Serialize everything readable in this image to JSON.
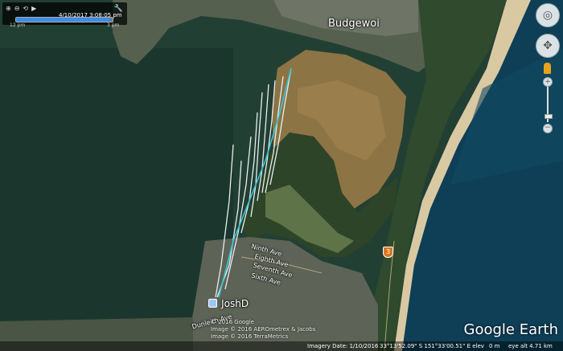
{
  "time_slider": {
    "date_time": "4/10/2017   3:08:05 pm",
    "start_label": "12 pm",
    "end_label": "3 pm",
    "progress": 0.97
  },
  "places": {
    "budgewoi": "Budgewoi",
    "ninth_ave": "Ninth Ave",
    "eighth_ave": "Eighth Ave",
    "seventh_ave": "Seventh Ave",
    "sixth_ave": "Sixth Ave",
    "dunleith_ave": "Dunleith Ave",
    "placemark": "JoshD",
    "route_shield": "3"
  },
  "copyright": {
    "line1": "© 2016 Google",
    "line2": "Image © 2016 AEROmetrex & Jacobs",
    "line3": "Image © 2016 TerraMetrics"
  },
  "status_bar": {
    "imagery_date": "Imagery Date: 1/10/2016",
    "coords": "33°13'52.09\" S  151°33'00.51\" E  elev",
    "elev": "0 m",
    "eye_alt": "eye alt   4.71 km"
  },
  "logo": "Google Earth",
  "icons": [
    "zoom-in-icon",
    "zoom-out-icon",
    "speed-icon",
    "loop-icon",
    "wrench-icon",
    "compass-icon",
    "pan-icon",
    "person-icon",
    "zoom-slider-icon",
    "zoom-plus-icon",
    "zoom-minus-icon",
    "placemark-icon",
    "route-shield-icon"
  ],
  "colors": {
    "lake": "#1d3b30",
    "track_white": "#e8eef2",
    "track_cyan": "#37c6d4",
    "ocean": "#0e3f57",
    "beach": "#d9c9a3"
  }
}
